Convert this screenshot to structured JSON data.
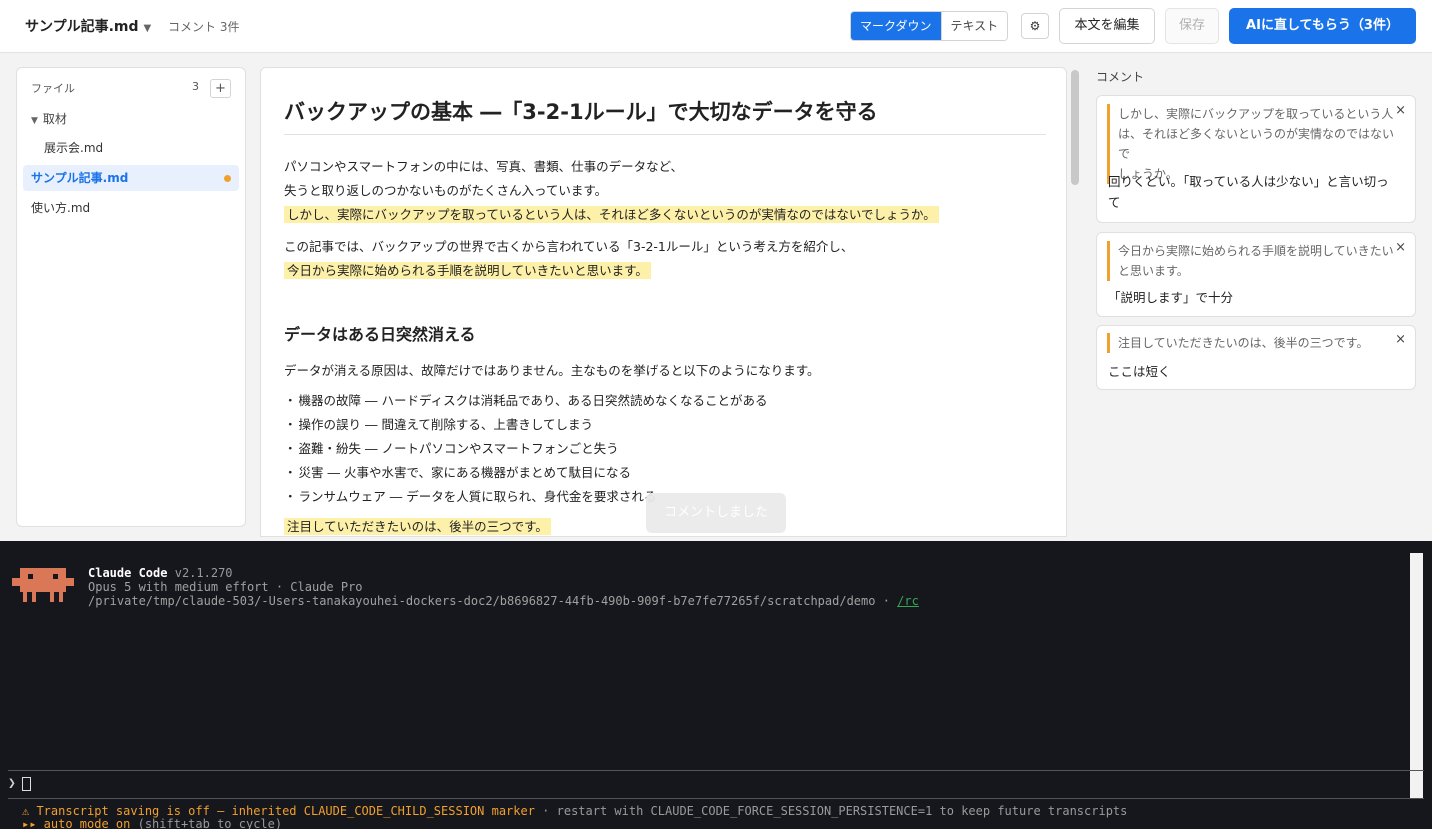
{
  "header": {
    "file_title": "サンプル記事.md",
    "caret": "▼",
    "comment_count": "コメント 3件",
    "mode_markdown": "マークダウン",
    "mode_text": "テキスト",
    "settings_icon": "⚙",
    "edit_label": "本文を編集",
    "save_label": "保存",
    "ai_label": "AIに直してもらう（3件）"
  },
  "sidebar": {
    "heading": "ファイル",
    "count": "3",
    "add": "+",
    "folder": {
      "arrow": "▼",
      "name": "取材"
    },
    "items": [
      {
        "name": "展示会.md"
      },
      {
        "name": "サンプル記事.md"
      },
      {
        "name": "使い方.md"
      }
    ]
  },
  "document": {
    "title": "バックアップの基本 ―「3-2-1ルール」で大切なデータを守る",
    "p1a": "パソコンやスマートフォンの中には、写真、書類、仕事のデータなど、",
    "p1b": "失うと取り返しのつかないものがたくさん入っています。",
    "p1c": "しかし、実際にバックアップを取っているという人は、それほど多くないというのが実情なのではないでしょうか。",
    "p2a": "この記事では、バックアップの世界で古くから言われている「3-2-1ルール」という考え方を紹介し、",
    "p2b": "今日から実際に始められる手順を説明していきたいと思います。",
    "h2": "データはある日突然消える",
    "p3": "データが消える原因は、故障だけではありません。主なものを挙げると以下のようになります。",
    "list": [
      "機器の故障 ― ハードディスクは消耗品であり、ある日突然読めなくなることがある",
      "操作の誤り ― 間違えて削除する、上書きしてしまう",
      "盗難・紛失 ― ノートパソコンやスマートフォンごと失う",
      "災害 ― 火事や水害で、家にある機器がまとめて駄目になる",
      "ランサムウェア ― データを人質に取られ、身代金を要求される"
    ],
    "p4": "注目していただきたいのは、後半の三つです。"
  },
  "toast": "コメントしました",
  "comments": {
    "title": "コメント",
    "close": "×",
    "items": [
      {
        "quote": "しかし、実際にバックアップを取っているという人\nは、それほど多くないというのが実情なのではないで\nしょうか。",
        "body": "回りくどい。「取っている人は少ない」と言い切っ\nて"
      },
      {
        "quote": "今日から実際に始められる手順を説明していきたい\nと思います。",
        "body": "「説明します」で十分"
      },
      {
        "quote": "注目していただきたいのは、後半の三つです。",
        "body": "ここは短く"
      }
    ]
  },
  "terminal": {
    "app_name": "Claude Code",
    "version": "v2.1.270",
    "model_line": "Opus 5 with medium effort · Claude Pro",
    "path": "/private/tmp/claude-503/-Users-tanakayouhei-dockers-doc2/b8696827-44fb-490b-909f-b7e7fe77265f/scratchpad/demo · ",
    "rc": "/rc",
    "prompt": "❯",
    "warn_main": "⚠ Transcript saving is off — inherited CLAUDE_CODE_CHILD_SESSION marker",
    "warn_rest": " · restart with CLAUDE_CODE_FORCE_SESSION_PERSISTENCE=1 to keep future transcripts",
    "auto_main": "▸▸ auto mode on",
    "auto_rest": " (shift+tab to cycle)"
  },
  "colors": {
    "accent": "#1a73e8",
    "highlight": "#fdf0a8",
    "comment_bar": "#f0a02c",
    "terminal_bg": "#16161d",
    "mascot": "#d97757"
  }
}
